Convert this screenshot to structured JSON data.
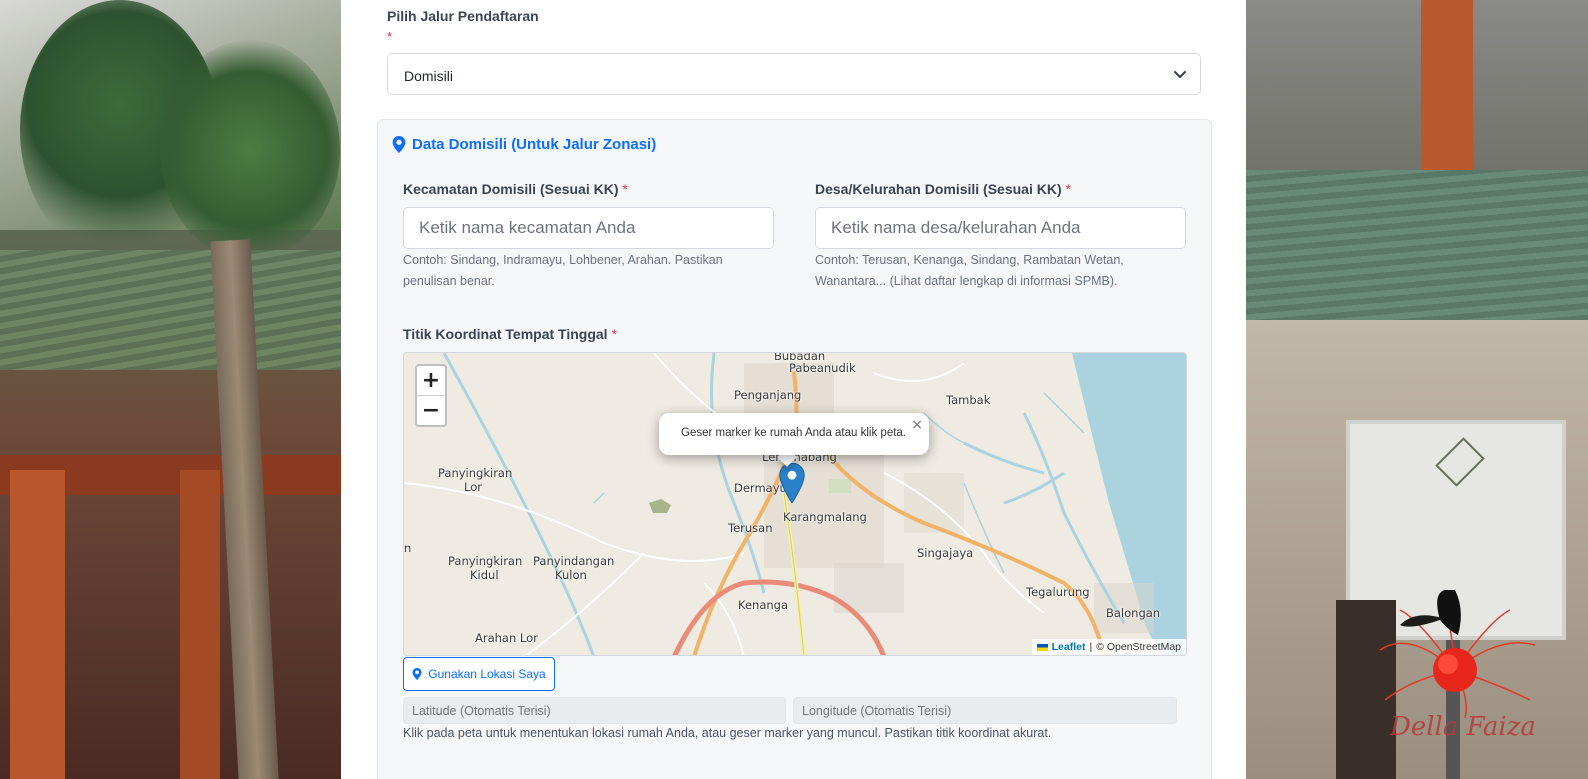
{
  "form": {
    "jalur_label": "Pilih Jalur Pendaftaran",
    "required_mark": "*",
    "jalur_selected": "Domisili"
  },
  "domisili": {
    "title": "Data Domisili (Untuk Jalur Zonasi)",
    "kecamatan_label": "Kecamatan Domisili (Sesuai KK)",
    "kecamatan_placeholder": "Ketik nama kecamatan Anda",
    "kecamatan_help": "Contoh: Sindang, Indramayu, Lohbener, Arahan. Pastikan penulisan benar.",
    "desa_label": "Desa/Kelurahan Domisili (Sesuai KK)",
    "desa_placeholder": "Ketik nama desa/kelurahan Anda",
    "desa_help": "Contoh: Terusan, Kenanga, Sindang, Rambatan Wetan, Wanantara... (Lihat daftar lengkap di informasi SPMB).",
    "titik_label": "Titik Koordinat Tempat Tinggal"
  },
  "map": {
    "zoom_in": "+",
    "zoom_out": "−",
    "popup_text": "Geser marker ke rumah Anda atau klik peta.",
    "popup_close": "×",
    "attribution_leaflet": "Leaflet",
    "attribution_sep": "|",
    "attribution_osm": "© OpenStreetMap",
    "place_labels": {
      "pabean": "Pabeanudik",
      "penganjang": "Penganjang",
      "tambak": "Tambak",
      "lemahabang": "Lemahabang",
      "dermayu": "Dermayu",
      "terusan": "Terusan",
      "karangmalang": "Karangmalang",
      "singajaya": "Singajaya",
      "panyingkiran_lor_1": "Panyingkiran",
      "panyingkiran_lor_2": "Lor",
      "panyingkiran_kidul_1": "Panyingkiran",
      "panyingkiran_kidul_2": "Kidul",
      "panyindangan_1": "Panyindangan",
      "panyindangan_2": "Kulon",
      "kenanga": "Kenanga",
      "tegalurung": "Tegalurung",
      "balongan": "Balongan",
      "arahan_lor": "Arahan Lor",
      "edge_n": "n",
      "top_cut": "Bubadan"
    }
  },
  "location": {
    "button_label": "Gunakan Lokasi Saya",
    "lat_placeholder": "Latitude (Otomatis Terisi)",
    "lng_placeholder": "Longitude (Otomatis Terisi)",
    "help": "Klik pada peta untuk menentukan lokasi rumah Anda, atau geser marker yang muncul. Pastikan titik koordinat akurat."
  },
  "decoration": {
    "signature": "Della Faiza"
  },
  "colors": {
    "accent": "#0d6efd",
    "required": "#dc3545",
    "panel_bg": "#f6f7f9",
    "water": "#aad3df",
    "marker": "#2a81cb"
  },
  "icons": {
    "panel_title": "map-pin-icon",
    "select": "chevron-down-icon",
    "location_button": "map-pin-icon"
  }
}
